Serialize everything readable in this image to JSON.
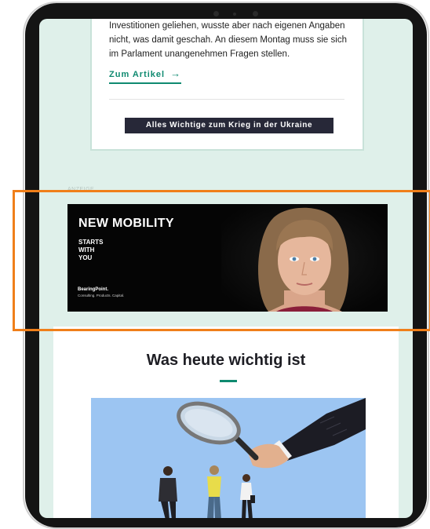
{
  "article": {
    "text_lines": [
      "Investitionen geliehen, wusste aber nach eigenen Angaben",
      "nicht, was damit geschah. An diesem Montag muss sie sich",
      "im Parlament unangenehmen Fragen stellen."
    ],
    "link_label": "Zum Artikel",
    "link_arrow": "→",
    "button_label": "Alles Wichtige zum Krieg in der Ukraine"
  },
  "ad": {
    "label": "ANZEIGE",
    "headline": "NEW MOBILITY",
    "sub_lines": [
      "STARTS",
      "WITH",
      "YOU"
    ],
    "brand": "BearingPoint.",
    "tagline": "Consulting. Products. Capital."
  },
  "section": {
    "title": "Was heute wichtig ist"
  },
  "colors": {
    "accent": "#0f8a70",
    "screen_background": "#dff0ea",
    "button_background": "#272838",
    "highlight_border": "#f07f1a"
  },
  "icons": [
    "right-arrow-icon",
    "magnifying-glass-icon"
  ]
}
